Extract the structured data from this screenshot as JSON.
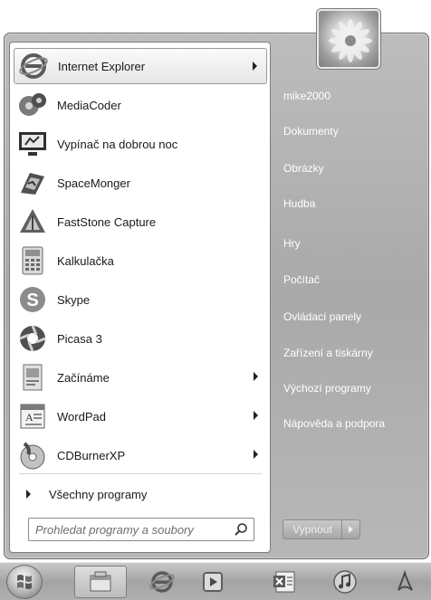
{
  "programs": [
    {
      "label": "Internet Explorer",
      "icon": "internet-explorer-icon",
      "submenu": true
    },
    {
      "label": "MediaCoder",
      "icon": "mediacoder-icon",
      "submenu": false
    },
    {
      "label": "Vypínač na dobrou noc",
      "icon": "monitor-power-icon",
      "submenu": false
    },
    {
      "label": "SpaceMonger",
      "icon": "spacemonger-icon",
      "submenu": false
    },
    {
      "label": "FastStone Capture",
      "icon": "faststone-capture-icon",
      "submenu": false
    },
    {
      "label": "Kalkulačka",
      "icon": "calculator-icon",
      "submenu": false
    },
    {
      "label": "Skype",
      "icon": "skype-icon",
      "submenu": false
    },
    {
      "label": "Picasa 3",
      "icon": "picasa-icon",
      "submenu": false
    },
    {
      "label": "Začínáme",
      "icon": "getting-started-icon",
      "submenu": true
    },
    {
      "label": "WordPad",
      "icon": "wordpad-icon",
      "submenu": true
    },
    {
      "label": "CDBurnerXP",
      "icon": "cdburnerxp-icon",
      "submenu": true
    }
  ],
  "all_programs": {
    "label": "Všechny programy"
  },
  "search": {
    "placeholder": "Prohledat programy a soubory"
  },
  "right_links": [
    {
      "label": "mike2000"
    },
    {
      "label": "Dokumenty"
    },
    {
      "label": "Obrázky"
    },
    {
      "label": "Hudba"
    },
    {
      "label": "Hry"
    },
    {
      "label": "Počítač"
    },
    {
      "label": "Ovládací panely"
    },
    {
      "label": "Zařízení a tiskárny"
    },
    {
      "label": "Výchozí programy"
    },
    {
      "label": "Nápověda a podpora"
    }
  ],
  "shutdown": {
    "label": "Vypnout"
  },
  "taskbar": {
    "items": [
      {
        "icon": "file-explorer-icon",
        "active": true
      },
      {
        "icon": "internet-explorer-icon",
        "active": false
      },
      {
        "icon": "media-player-icon",
        "active": false
      },
      {
        "icon": "excel-icon",
        "active": false
      },
      {
        "icon": "itunes-icon",
        "active": false
      },
      {
        "icon": "acrobat-icon",
        "active": false
      }
    ]
  }
}
